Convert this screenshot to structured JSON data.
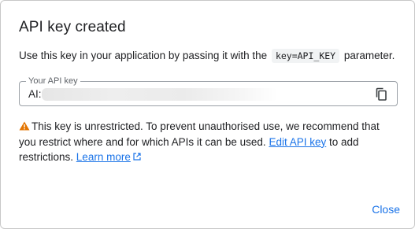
{
  "dialog": {
    "title": "API key created",
    "desc_before": "Use this key in your application by passing it with the",
    "desc_code": "key=API_KEY",
    "desc_after": "parameter.",
    "field": {
      "label": "Your API key",
      "value_prefix": "AI:"
    },
    "warning": {
      "text_1": "This key is unrestricted. To prevent unauthorised use, we recommend that you restrict where and for which APIs it can be used.",
      "link_edit": "Edit API key",
      "text_2": "to add restrictions.",
      "link_learn": "Learn more"
    },
    "close_label": "Close"
  },
  "colors": {
    "accent": "#1a73e8",
    "warning": "#e37400",
    "border": "#9aa0a6"
  },
  "icons": {
    "copy": "copy-icon",
    "warning": "warning-icon",
    "external": "external-link-icon"
  }
}
